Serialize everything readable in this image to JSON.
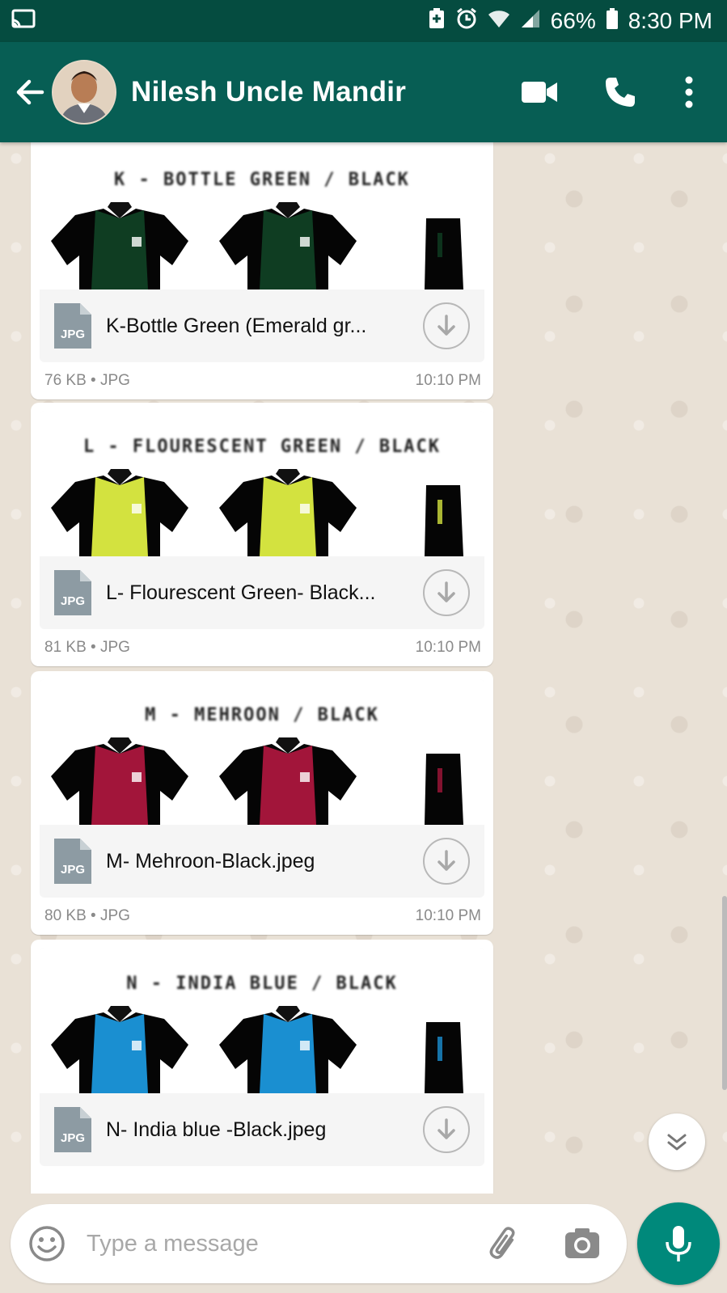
{
  "status_bar": {
    "battery": "66%",
    "time": "8:30 PM"
  },
  "header": {
    "contact_name": "Nilesh Uncle Mandir"
  },
  "messages": [
    {
      "preview_title": "K - BOTTLE GREEN / BLACK",
      "file_type_badge": "JPG",
      "file_name": "K-Bottle Green (Emerald gr...",
      "size": "76 KB",
      "type": "JPG",
      "time": "10:10 PM",
      "shirt_color": "#0f3d22"
    },
    {
      "preview_title": "L - FLOURESCENT GREEN / BLACK",
      "file_type_badge": "JPG",
      "file_name": "L- Flourescent Green- Black...",
      "size": "81 KB",
      "type": "JPG",
      "time": "10:10 PM",
      "shirt_color": "#d3e23f"
    },
    {
      "preview_title": "M - MEHROON / BLACK",
      "file_type_badge": "JPG",
      "file_name": "M- Mehroon-Black.jpeg",
      "size": "80 KB",
      "type": "JPG",
      "time": "10:10 PM",
      "shirt_color": "#a2153a"
    },
    {
      "preview_title": "N - INDIA BLUE / BLACK",
      "file_type_badge": "JPG",
      "file_name": "N- India blue -Black.jpeg",
      "size": "",
      "type": "",
      "time": "",
      "shirt_color": "#1a8fd1"
    }
  ],
  "composer": {
    "placeholder": "Type a message"
  },
  "colors": {
    "header": "#075e54",
    "status_bar": "#054c40",
    "accent": "#00897b"
  }
}
